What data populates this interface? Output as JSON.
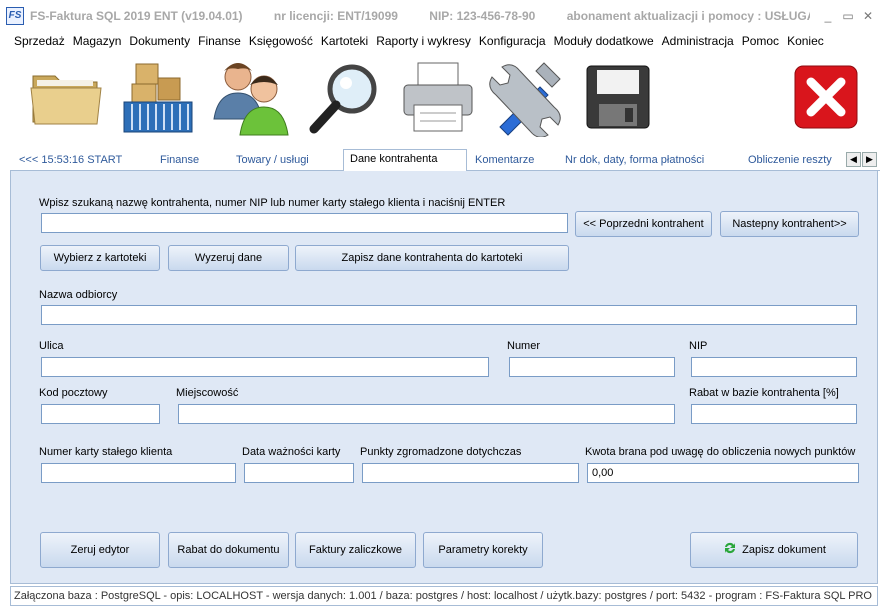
{
  "window": {
    "app_icon_text": "FS",
    "title_parts": [
      "FS-Faktura SQL 2019 ENT (v19.04.01)",
      "nr licencji: ENT/19099",
      "NIP: 123-456-78-90",
      "abonament aktualizacji i pomocy : USŁUGA A..."
    ],
    "minimize": "_",
    "maximize": "▭",
    "close": "✕"
  },
  "menu": [
    "Sprzedaż",
    "Magazyn",
    "Dokumenty",
    "Finanse",
    "Księgowość",
    "Kartoteki",
    "Raporty i wykresy",
    "Konfiguracja",
    "Moduły dodatkowe",
    "Administracja",
    "Pomoc",
    "Koniec"
  ],
  "toolbar": [
    "folder-icon",
    "warehouse-boxes-icon",
    "users-icon",
    "search-magnifier-icon",
    "printer-icon",
    "tools-icon",
    "save-disk-icon",
    "close-red-icon"
  ],
  "tabs": {
    "start": "<<<  15:53:16  START",
    "finanse": "Finanse",
    "towary": "Towary  / usługi",
    "dane": "Dane kontrahenta",
    "komentarze": "Komentarze",
    "nrdok": "Nr dok, daty, forma płatności",
    "obliczenie": "Obliczenie reszty",
    "prev": "◀",
    "next": "▶"
  },
  "search": {
    "label": "Wpisz szukaną nazwę kontrahenta, numer NIP lub numer karty stałego klienta i naciśnij ENTER",
    "value": "",
    "prev_button": "<< Poprzedni kontrahent",
    "next_button": "Nastepny kontrahent>>"
  },
  "actions": {
    "select": "Wybierz z kartoteki",
    "reset": "Wyzeruj dane",
    "save_to_file": "Zapisz dane kontrahenta do kartoteki"
  },
  "fields": {
    "recipient_label": "Nazwa odbiorcy",
    "recipient_value": "",
    "street_label": "Ulica",
    "street_value": "",
    "number_label": "Numer",
    "number_value": "",
    "nip_label": "NIP",
    "nip_value": "",
    "postal_label": "Kod pocztowy",
    "postal_value": "",
    "city_label": "Miejscowość",
    "city_value": "",
    "discount_label": "Rabat w bazie kontrahenta  [%]",
    "discount_value": "",
    "card_label": "Numer karty stałego klienta",
    "card_value": "",
    "validity_label": "Data ważności karty",
    "validity_value": "",
    "points_label": "Punkty zgromadzone dotychczas",
    "points_value": "",
    "amount_label": "Kwota brana pod uwagę do obliczenia nowych punktów",
    "amount_value": "0,00"
  },
  "bottom_buttons": {
    "reset_editor": "Zeruj edytor",
    "discount_doc": "Rabat do dokumentu",
    "advance_invoices": "Faktury zaliczkowe",
    "correction_params": "Parametry korekty",
    "save_document": "Zapisz dokument"
  },
  "status": "Załączona baza : PostgreSQL - opis: LOCALHOST - wersja danych: 1.001  / baza: postgres / host: localhost / użytk.bazy: postgres /  port: 5432  -  program :  FS-Faktura SQL PRO"
}
